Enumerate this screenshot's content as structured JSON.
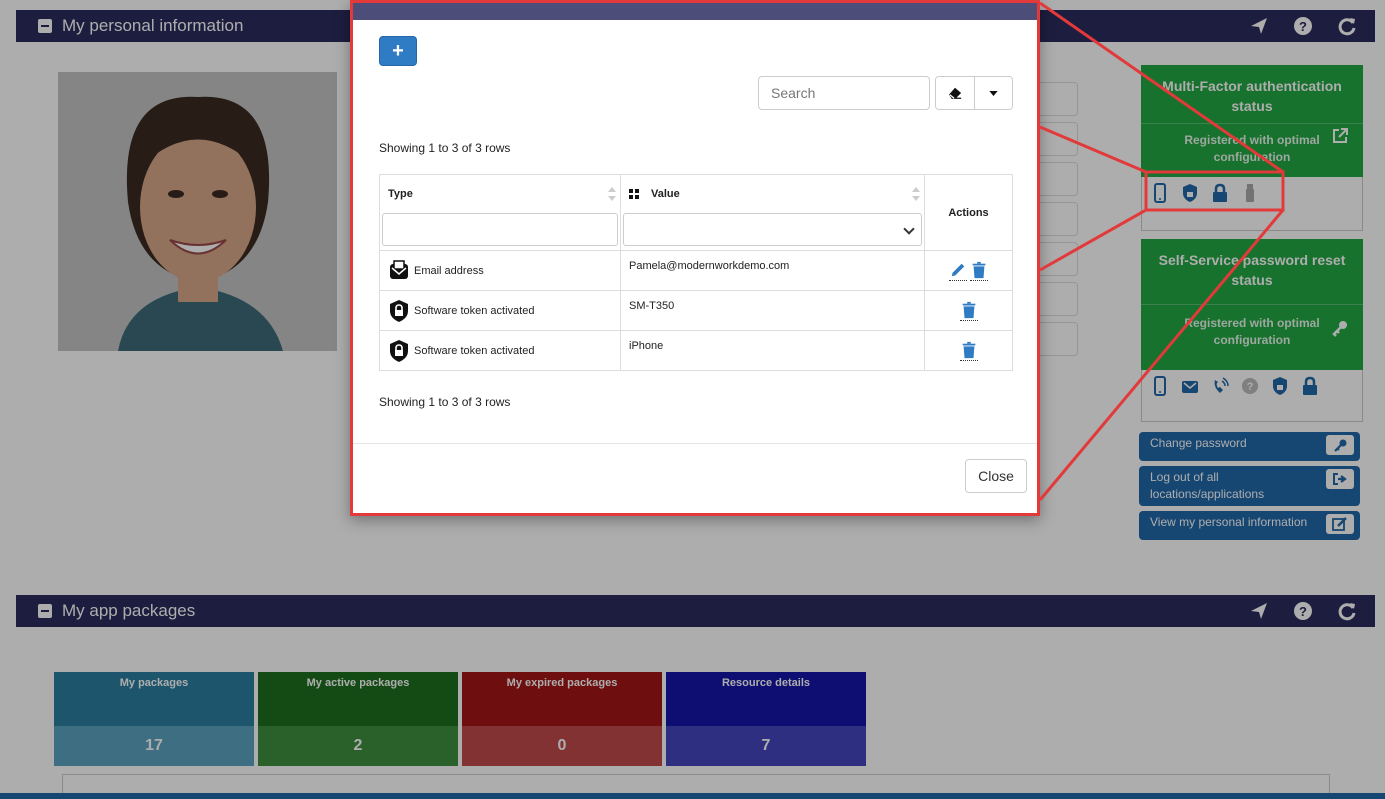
{
  "personal_panel": {
    "title": "My personal information"
  },
  "mfa_card": {
    "title": "Multi-Factor authentication status",
    "subtitle": "Registered with optimal configuration",
    "icons": [
      "mobile-phone-icon",
      "shield-lock-icon",
      "padlock-icon",
      "usb-key-icon"
    ]
  },
  "sspr_card": {
    "title": "Self-Service password reset status",
    "subtitle": "Registered with optimal configuration",
    "icons": [
      "mobile-phone-icon",
      "email-envelope-icon",
      "phone-call-icon",
      "question-icon",
      "shield-lock-icon",
      "padlock-icon"
    ]
  },
  "side_buttons": {
    "change_password": "Change password",
    "logout_all": "Log out of all locations/applications",
    "view_info": "View my personal information"
  },
  "packages_panel": {
    "title": "My app packages",
    "tiles": [
      {
        "label": "My packages",
        "value": "17",
        "color": "#2b7fa0"
      },
      {
        "label": "My active packages",
        "value": "2",
        "color": "#1e6f1e"
      },
      {
        "label": "My expired packages",
        "value": "0",
        "color": "#a31515"
      },
      {
        "label": "Resource details",
        "value": "7",
        "color": "#1414a8"
      }
    ]
  },
  "modal": {
    "add_label": "+",
    "search_placeholder": "Search",
    "showing_top": "Showing 1 to 3 of 3 rows",
    "showing_bottom": "Showing 1 to 3 of 3 rows",
    "columns": {
      "type": "Type",
      "value": "Value",
      "actions": "Actions"
    },
    "rows": [
      {
        "type": "Email address",
        "type_icon": "email-envelope-icon",
        "value": "Pamela@modernworkdemo.com",
        "actions": [
          "edit-icon",
          "delete-icon"
        ]
      },
      {
        "type": "Software token activated",
        "type_icon": "shield-lock-icon",
        "value": "SM-T350",
        "actions": [
          "delete-icon"
        ]
      },
      {
        "type": "Software token activated",
        "type_icon": "shield-lock-icon",
        "value": "iPhone",
        "actions": [
          "delete-icon"
        ]
      }
    ],
    "close_label": "Close"
  },
  "colors": {
    "panel_header": "#2b2b5e",
    "status_green": "#21a843",
    "primary_blue": "#2168a8",
    "callout_red": "#e23a3a"
  }
}
